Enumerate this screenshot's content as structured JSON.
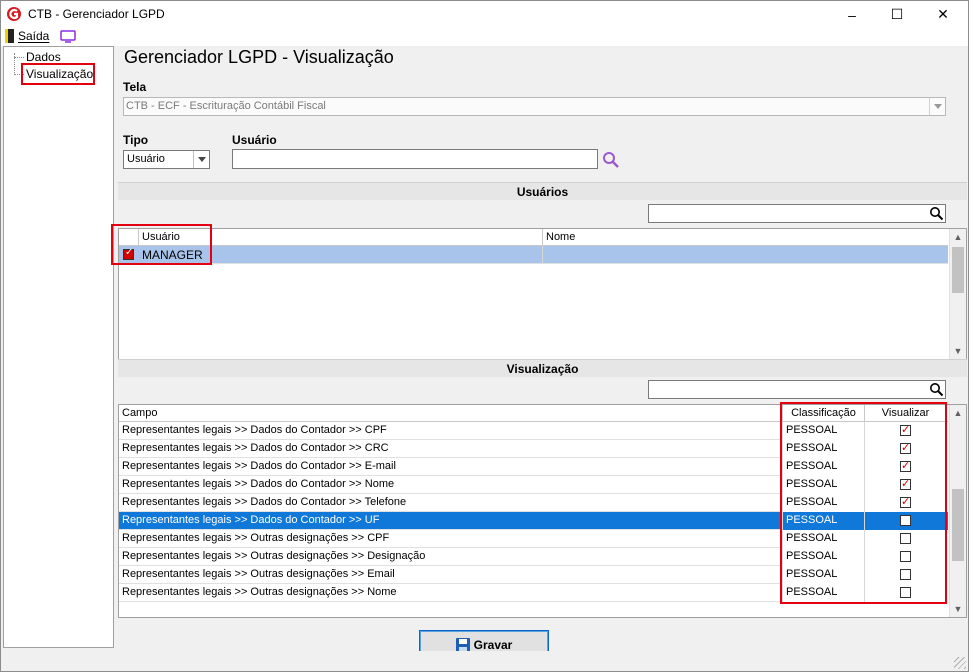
{
  "window": {
    "title": "CTB - Gerenciador LGPD",
    "minimize_glyph": "–",
    "maximize_glyph": "☐",
    "close_glyph": "✕"
  },
  "menu": {
    "exit_label": "Saída",
    "icons": [
      "door-exit-icon",
      "monitor-icon"
    ]
  },
  "sidebar": {
    "items": [
      {
        "label": "Dados"
      },
      {
        "label": "Visualização",
        "highlighted": true
      }
    ]
  },
  "page": {
    "title": "Gerenciador LGPD - Visualização"
  },
  "tela": {
    "label": "Tela",
    "value": "CTB - ECF - Escrituração Contábil Fiscal"
  },
  "tipo": {
    "label": "Tipo",
    "value": "Usuário"
  },
  "usuario": {
    "label": "Usuário",
    "value": ""
  },
  "usuarios_section": {
    "title": "Usuários",
    "search_value": "",
    "columns": [
      "Usuário",
      "Nome"
    ],
    "rows": [
      {
        "checked": true,
        "usuario": "MANAGER",
        "nome": ""
      }
    ]
  },
  "visualizacao_section": {
    "title": "Visualização",
    "search_value": "",
    "columns": [
      "Campo",
      "Classificação",
      "Visualizar"
    ],
    "rows": [
      {
        "campo": "Representantes legais >> Dados do Contador >> CPF",
        "classificacao": "PESSOAL",
        "visualizar": true
      },
      {
        "campo": "Representantes legais >> Dados do Contador >> CRC",
        "classificacao": "PESSOAL",
        "visualizar": true
      },
      {
        "campo": "Representantes legais >> Dados do Contador >> E-mail",
        "classificacao": "PESSOAL",
        "visualizar": true
      },
      {
        "campo": "Representantes legais >> Dados do Contador >> Nome",
        "classificacao": "PESSOAL",
        "visualizar": true
      },
      {
        "campo": "Representantes legais >> Dados do Contador >> Telefone",
        "classificacao": "PESSOAL",
        "visualizar": true
      },
      {
        "campo": "Representantes legais >> Dados do Contador >> UF",
        "classificacao": "PESSOAL",
        "visualizar": false,
        "selected": true
      },
      {
        "campo": "Representantes legais >> Outras designações >> CPF",
        "classificacao": "PESSOAL",
        "visualizar": false
      },
      {
        "campo": "Representantes legais >> Outras designações >> Designação",
        "classificacao": "PESSOAL",
        "visualizar": false
      },
      {
        "campo": "Representantes legais >> Outras designações >> Email",
        "classificacao": "PESSOAL",
        "visualizar": false
      },
      {
        "campo": "Representantes legais >> Outras designações >> Nome",
        "classificacao": "PESSOAL",
        "visualizar": false
      }
    ]
  },
  "actions": {
    "save_label": "Gravar"
  },
  "colors": {
    "highlight_box": "#e3000f",
    "selection": "#0f78d8",
    "selection_soft": "#a9c4ea",
    "accent": "#1e5fb5"
  }
}
